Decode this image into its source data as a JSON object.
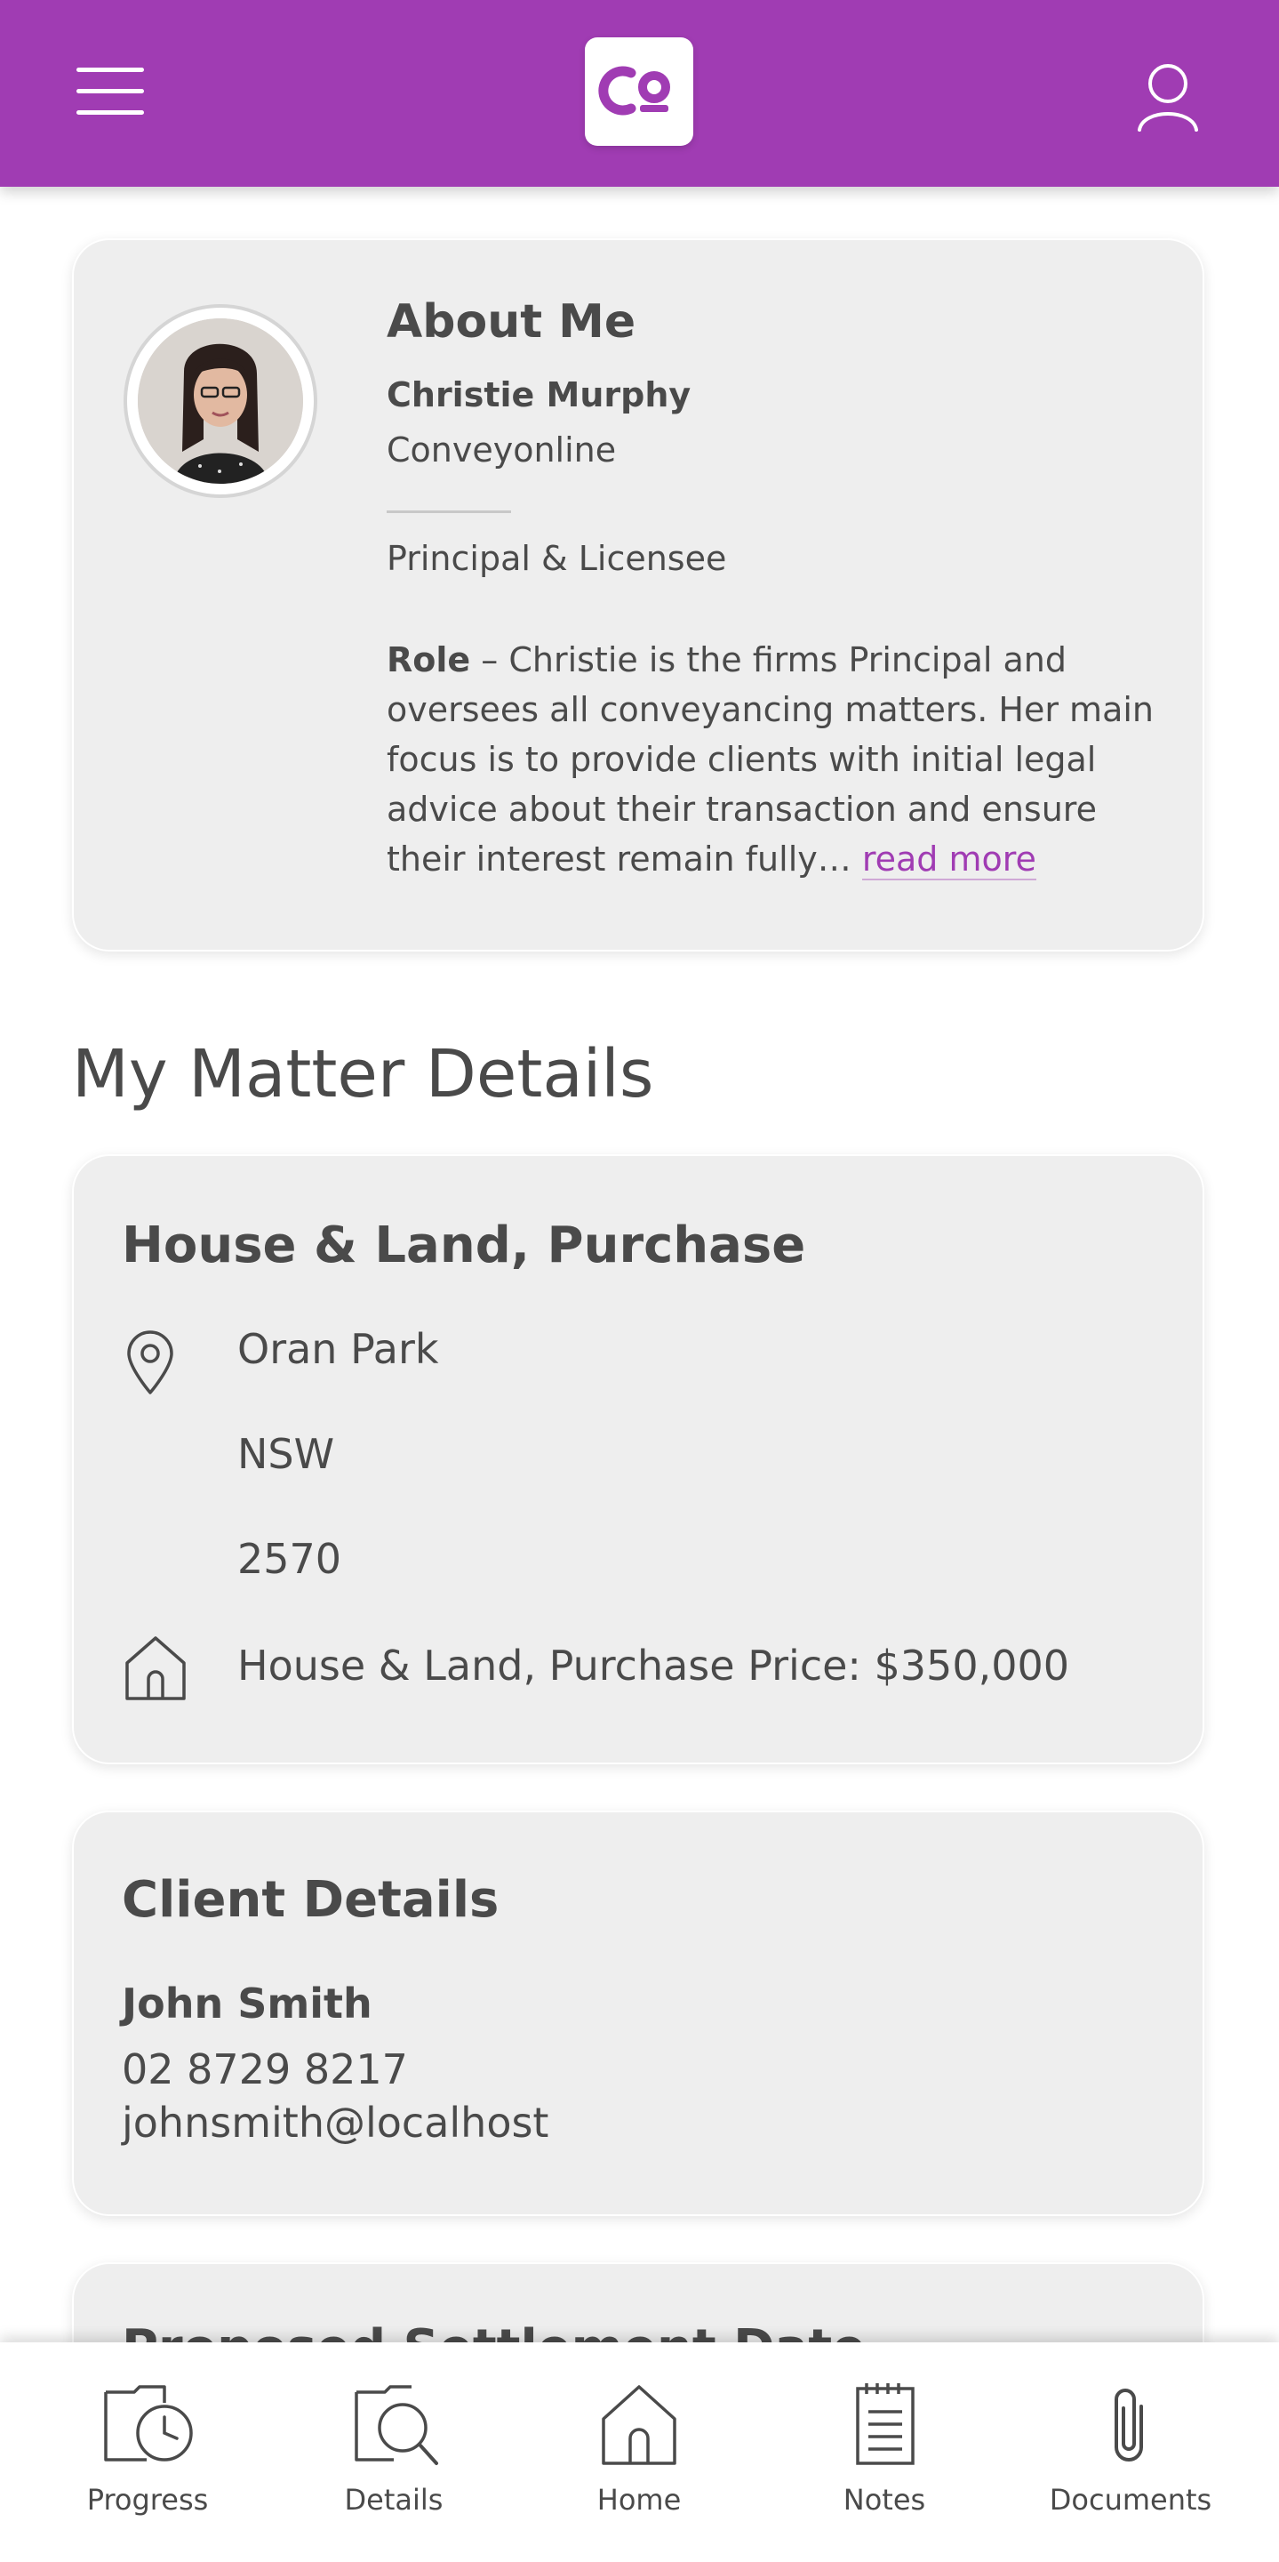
{
  "header": {
    "logo_text": "CO",
    "menu_icon": "hamburger-icon",
    "user_icon": "user-icon"
  },
  "about": {
    "title": "About Me",
    "name": "Christie Murphy",
    "company": "Conveyonline",
    "position": "Principal & Licensee",
    "bio_label": "Role",
    "bio_text": " – Christie is the firms Principal and oversees all conveyancing matters. Her main focus is to provide clients with initial legal advice about their transaction and ensure their interest remain fully… ",
    "read_more": "read more"
  },
  "matter": {
    "section_title": "My Matter Details",
    "card_title": "House & Land, Purchase",
    "suburb": "Oran Park",
    "state": "NSW",
    "postcode": "2570",
    "price_line": "House & Land, Purchase Price: $350,000"
  },
  "client": {
    "title": "Client Details",
    "name": "John Smith",
    "phone": "02 8729 8217",
    "email": "johnsmith@localhost"
  },
  "next_card": {
    "title": "Proposed Settlement Date"
  },
  "nav": {
    "items": [
      {
        "label": "Progress",
        "icon": "progress-icon"
      },
      {
        "label": "Details",
        "icon": "details-icon"
      },
      {
        "label": "Home",
        "icon": "home-icon"
      },
      {
        "label": "Notes",
        "icon": "notes-icon"
      },
      {
        "label": "Documents",
        "icon": "documents-icon"
      }
    ]
  },
  "colors": {
    "brand": "#a03cb3",
    "card_bg": "#eeeeee",
    "text": "#4a4a4a"
  }
}
